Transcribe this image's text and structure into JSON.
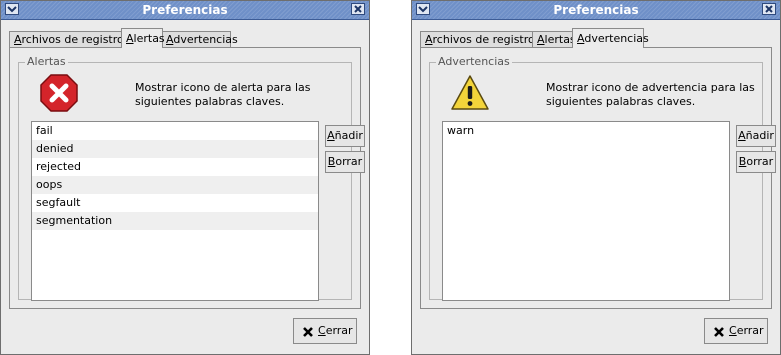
{
  "windows": [
    {
      "title": "Preferencias",
      "tabs": [
        {
          "label_pre": "",
          "label_mn": "A",
          "label_post": "rchivos de registro",
          "active": false
        },
        {
          "label_pre": "",
          "label_mn": "A",
          "label_post": "lertas",
          "active": true
        },
        {
          "label_pre": "",
          "label_mn": "A",
          "label_post": "dvertencias",
          "active": false
        }
      ],
      "frame_label": "Alertas",
      "icon": "error-icon",
      "description": "Mostrar icono de alerta para las siguientes palabras claves.",
      "keywords": [
        "fail",
        "denied",
        "rejected",
        "oops",
        "segfault",
        "segmentation"
      ],
      "add_button": {
        "mn": "A",
        "rest": "ñadir"
      },
      "remove_button": {
        "mn": "B",
        "rest": "orrar"
      },
      "close_button": {
        "mn": "C",
        "rest": "errar"
      }
    },
    {
      "title": "Preferencias",
      "tabs": [
        {
          "label_pre": "",
          "label_mn": "A",
          "label_post": "rchivos de registro",
          "active": false
        },
        {
          "label_pre": "",
          "label_mn": "A",
          "label_post": "lertas",
          "active": false
        },
        {
          "label_pre": "",
          "label_mn": "A",
          "label_post": "dvertencias",
          "active": true
        }
      ],
      "frame_label": "Advertencias",
      "icon": "warning-icon",
      "description": "Mostrar icono de advertencia para las siguientes palabras claves.",
      "keywords": [
        "warn"
      ],
      "add_button": {
        "mn": "A",
        "rest": "ñadir"
      },
      "remove_button": {
        "mn": "B",
        "rest": "orrar"
      },
      "close_button": {
        "mn": "C",
        "rest": "errar"
      }
    }
  ],
  "colors": {
    "titlebar": "#6f90c8",
    "error_red": "#d4242a",
    "warning_yellow": "#f3d43a"
  }
}
